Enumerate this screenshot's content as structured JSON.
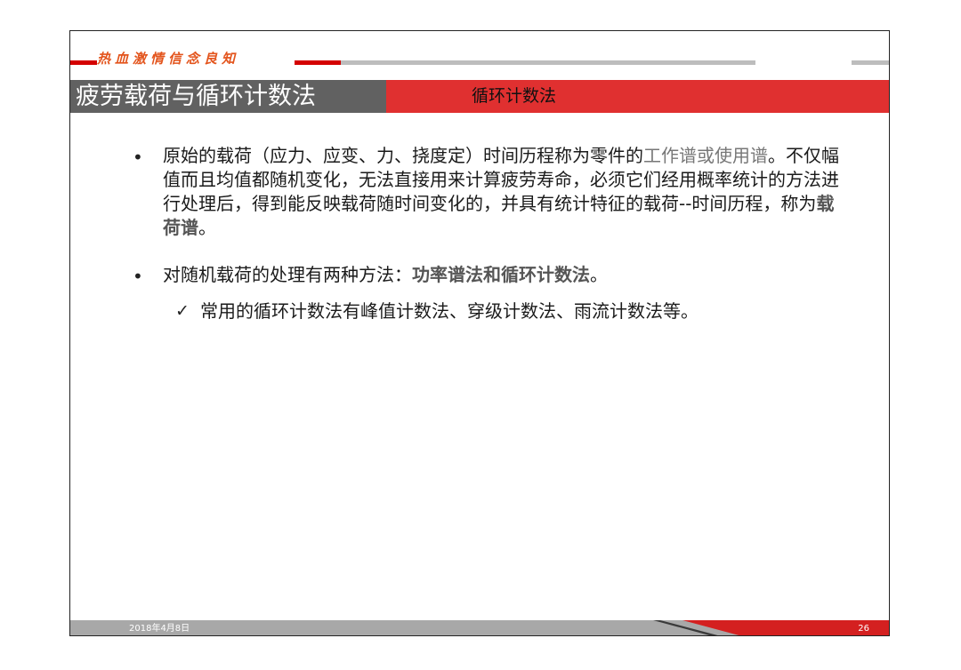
{
  "header": {
    "motto": "热血激情信念良知",
    "title": "疲劳载荷与循环计数法",
    "subtitle": "循环计数法"
  },
  "content": {
    "bullet_symbol": "•",
    "check_symbol": "✓",
    "p1_part1": "原始的载荷（应力、应变、力、挠度定）时间历程称为零件的",
    "p1_term": "工作谱或使用谱",
    "p1_part2": "。不仅幅值而且均值都随机变化，无法直接用来计算疲劳寿命，必须它们经用概率统计的方法进行处理后，得到能反映载荷随时间变化的，并具有统计特征的载荷--时间历程，称为",
    "p1_bold": "载荷谱",
    "p1_end": "。",
    "p2_text": "对随机载荷的处理有两种方法：",
    "p2_bold": "功率谱法和循环计数法",
    "p2_end": "。",
    "sub1_text": "常用的循环计数法有峰值计数法、穿级计数法、雨流计数法等。"
  },
  "footer": {
    "date": "2018年4月8日",
    "page": "26"
  }
}
